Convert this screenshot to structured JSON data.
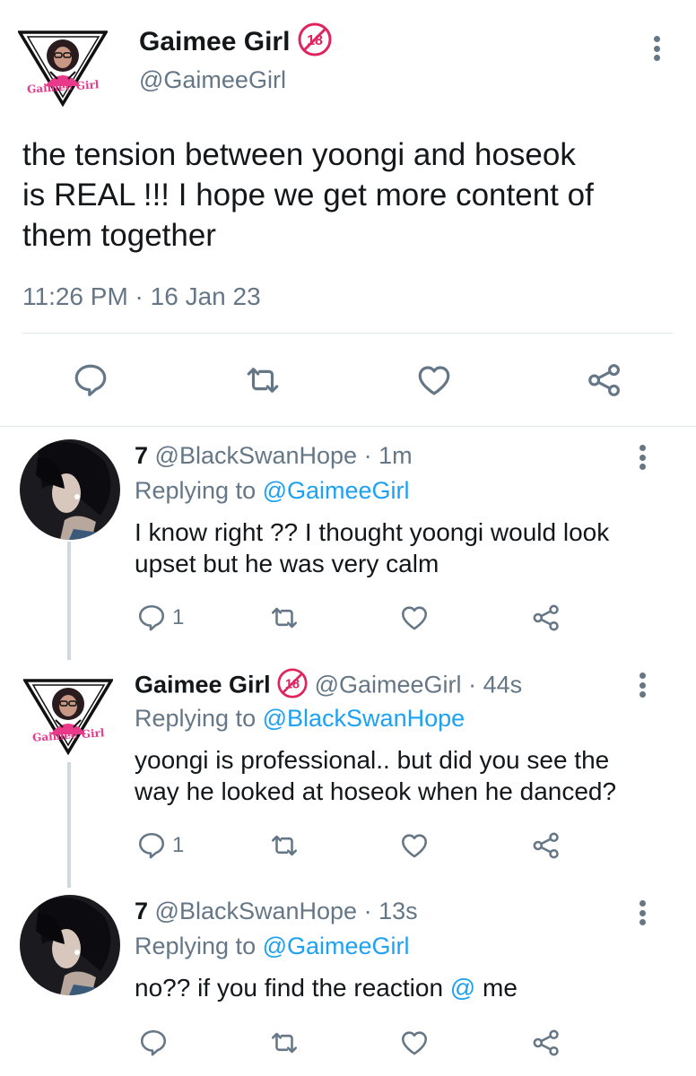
{
  "main_tweet": {
    "display_name": "Gaimee Girl",
    "handle": "@GaimeeGirl",
    "logo_text": "Gaimee Girl",
    "text_line1": "the tension between yoongi and hoseok",
    "text_line2": "is REAL !!! I hope we get more content of",
    "text_line3": "them together",
    "timestamp": "11:26 PM · 16 Jan 23"
  },
  "age_badge": "18",
  "replies": [
    {
      "display_name": "7",
      "handle": "@BlackSwanHope",
      "time": "· 1m",
      "replying_prefix": "Replying to",
      "replying_to": "@GaimeeGirl",
      "text_line1": "I know right ?? I thought yoongi would look",
      "text_line2": "upset but he was very calm",
      "reply_count": "1"
    },
    {
      "display_name": "Gaimee Girl",
      "handle": "@GaimeeGirl",
      "time": "· 44s",
      "logo_text": "Gaimee Girl",
      "replying_prefix": "Replying to",
      "replying_to": "@BlackSwanHope",
      "text_line1": "yoongi is professional.. but did you see the",
      "text_line2": "way he looked at hoseok when he danced?",
      "reply_count": "1"
    },
    {
      "display_name": "7",
      "handle": "@BlackSwanHope",
      "time": "· 13s",
      "replying_prefix": "Replying to",
      "replying_to": "@GaimeeGirl",
      "text_before": "no?? if you find the reaction",
      "mention": "@",
      "text_after": "me"
    }
  ],
  "colors": {
    "link": "#1da1f2",
    "muted": "#657786",
    "logo_pink": "#e8398a",
    "badge_red": "#e0245e"
  },
  "icons": [
    "more-icon",
    "reply-icon",
    "retweet-icon",
    "like-icon",
    "share-icon",
    "age-18-badge-icon"
  ]
}
